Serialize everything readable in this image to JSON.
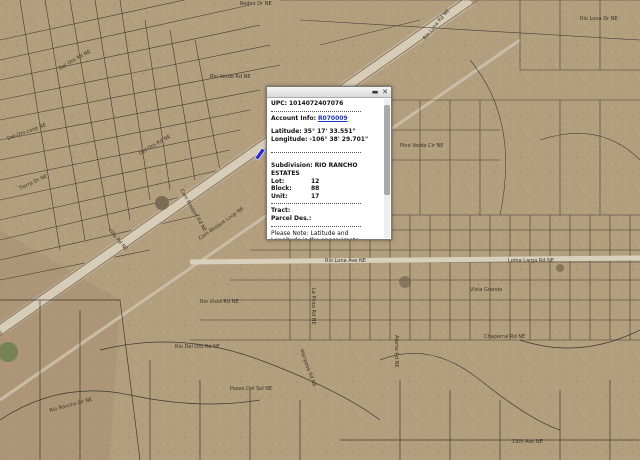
{
  "map": {
    "colors": {
      "terrain": "#b49f7f",
      "road": "#d8cfbd",
      "parcel_line": "#2d2a25",
      "highlight": "#2a2ad8"
    },
    "road_labels": [
      "Rodeo Dr NE",
      "Del Oro Rd NE",
      "Rio Verde Rd NE",
      "Del Oro Loop NE",
      "Del Oro Rd NE",
      "Pino Verde Cir NE",
      "Rio Luna Rd NE",
      "Rio Luna Dr NE",
      "Cam Bosque Rd NE",
      "Tierra Dr NE",
      "Cam Bosque Loop NE",
      "Villa Rd NE",
      "Rio Luna Ave NE",
      "Vista Grande",
      "Loma Larga Rd NE",
      "Rio Vista Rd NE",
      "La Pinta Rd NE",
      "Rio Del Oro Rd NE",
      "Paseo Del Sol NE",
      "Alamo Rd NE",
      "Chaparral Rd NE",
      "Mariposa Rd NE",
      "19th Ave NE",
      "Rio Rancho Dr NE"
    ]
  },
  "popup": {
    "minimize_icon": "minimize-icon",
    "close_icon": "close-icon",
    "upc_label": "UPC:",
    "upc_value": "1014072407076",
    "account_label": "Account Info:",
    "account_value": "R070009",
    "latitude_label": "Latitude:",
    "latitude_value": "35° 17' 33.551\"",
    "longitude_label": "Longitude:",
    "longitude_value": "-106° 38' 29.701\"",
    "subdivision_label": "Subdivision:",
    "subdivision_value": "RIO RANCHO ESTATES",
    "lot_label": "Lot:",
    "lot_value": "12",
    "block_label": "Block:",
    "block_value": "88",
    "unit_label": "Unit:",
    "unit_value": "17",
    "tract_label": "Tract:",
    "parcel_des_label": "Parcel Des.:",
    "note": "Please Note: Latitude and Longitude is the approximate center of the parcel shown"
  }
}
